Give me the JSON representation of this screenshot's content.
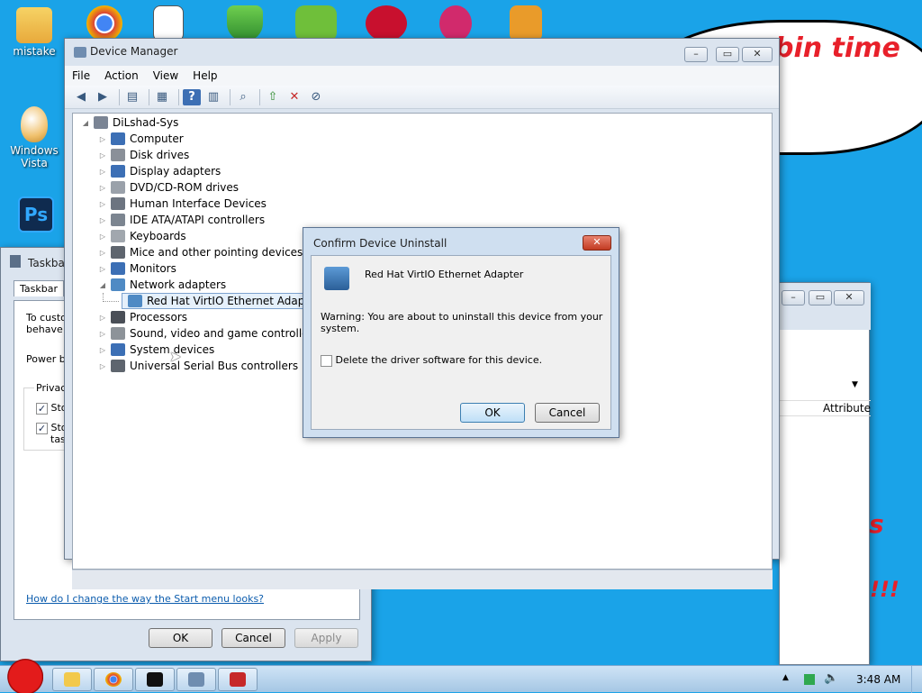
{
  "desktop": {
    "icons": [
      {
        "label": "mistake"
      },
      {
        "label": "Windows Vista"
      },
      {
        "label": "Ps"
      }
    ],
    "overlay_text": "bin  time",
    "scrawl": [
      "s",
      "!!!"
    ]
  },
  "taskbar_props": {
    "title": "Taskbar",
    "tab": "Taskbar",
    "text_lines": [
      "To custor",
      "behave ir",
      "Power bu",
      "Privacy",
      "Sto",
      "Sto",
      "task"
    ],
    "link": "How do I change the way the Start menu looks?",
    "ok": "OK",
    "cancel": "Cancel",
    "apply": "Apply"
  },
  "right_window": {
    "column_header": "Attribute"
  },
  "device_manager": {
    "title": "Device Manager",
    "menu": [
      "File",
      "Action",
      "View",
      "Help"
    ],
    "root": "DiLshad-Sys",
    "nodes": [
      {
        "label": "Computer",
        "color": "#3c6fb5"
      },
      {
        "label": "Disk drives",
        "color": "#8a9099"
      },
      {
        "label": "Display adapters",
        "color": "#3c6fb5"
      },
      {
        "label": "DVD/CD-ROM drives",
        "color": "#9aa1aa"
      },
      {
        "label": "Human Interface Devices",
        "color": "#6c7480"
      },
      {
        "label": "IDE ATA/ATAPI controllers",
        "color": "#7c8590"
      },
      {
        "label": "Keyboards",
        "color": "#a1a7ae"
      },
      {
        "label": "Mice and other pointing devices",
        "color": "#5e656e"
      },
      {
        "label": "Monitors",
        "color": "#3c6fb5"
      },
      {
        "label": "Network adapters",
        "color": "#4f8ac4"
      },
      {
        "label": "Red Hat VirtIO Ethernet Adapter",
        "color": "#4f8ac4"
      },
      {
        "label": "Processors",
        "color": "#4a4f57"
      },
      {
        "label": "Sound, video and game controllers",
        "color": "#8d9399"
      },
      {
        "label": "System devices",
        "color": "#3c6fb5"
      },
      {
        "label": "Universal Serial Bus controllers",
        "color": "#5e656e"
      }
    ]
  },
  "dialog": {
    "title": "Confirm Device Uninstall",
    "device": "Red Hat VirtIO Ethernet Adapter",
    "warning": "Warning: You are about to uninstall this device from your system.",
    "checkbox_label": "Delete the driver software for this device.",
    "ok": "OK",
    "cancel": "Cancel"
  },
  "taskbar": {
    "time": "3:48 AM"
  }
}
